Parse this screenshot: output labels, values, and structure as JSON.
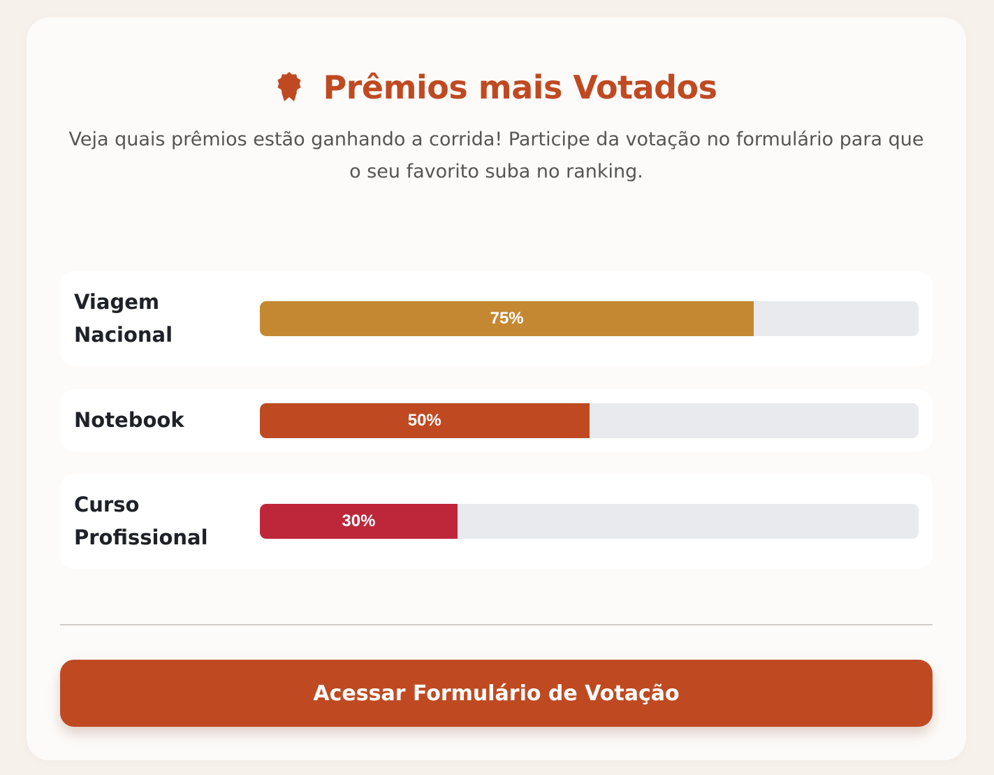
{
  "header": {
    "icon": "award-icon",
    "title": "Prêmios mais Votados"
  },
  "subtitle": "Veja quais prêmios estão ganhando a corrida! Participe da votação no formulário para que o seu favorito suba no ranking.",
  "ranking": [
    {
      "label": "Viagem Nacional",
      "percent": 75,
      "percent_label": "75%",
      "color": "#c48832"
    },
    {
      "label": "Notebook",
      "percent": 50,
      "percent_label": "50%",
      "color": "#bf4a22"
    },
    {
      "label": "Curso Profissional",
      "percent": 30,
      "percent_label": "30%",
      "color": "#be273a"
    }
  ],
  "cta": {
    "label": "Acessar Formulário de Votação"
  },
  "colors": {
    "accent": "#bf4a22",
    "track": "#e9eaed",
    "background": "#f7f1ec"
  }
}
